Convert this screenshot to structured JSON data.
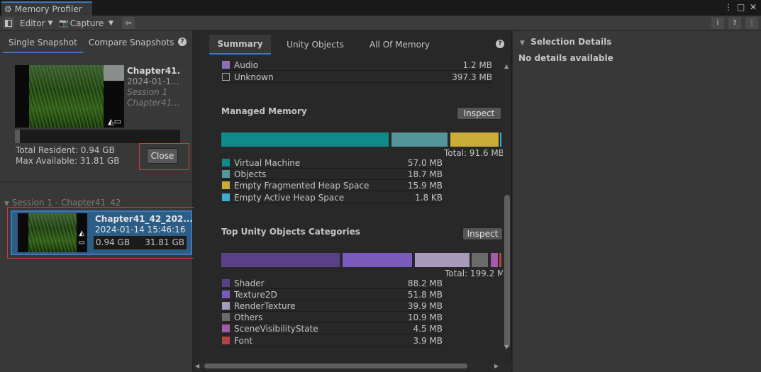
{
  "window": {
    "tab_title": "Memory Profiler"
  },
  "toolbar": {
    "target_label": "Editor",
    "capture_label": "Capture"
  },
  "left": {
    "tabs": [
      "Single Snapshot",
      "Compare Snapshots"
    ],
    "snapshot": {
      "name": "Chapter41...",
      "date": "2024-01-1...",
      "session": "Session 1",
      "project": "Chapter41...",
      "resident_label": "Total Resident: 0.94 GB",
      "available_label": "Max Available: 31.81 GB",
      "resident_fraction": 0.03
    },
    "close_label": "Close",
    "session_header": "Session 1 - Chapter41_42",
    "session_item": {
      "name": "Chapter41_42_202...",
      "date": "2024-01-14 15:46:16",
      "resident": "0.94 GB",
      "available": "31.81 GB"
    }
  },
  "center": {
    "tabs": [
      "Summary",
      "Unity Objects",
      "All Of Memory"
    ],
    "top_rows": [
      {
        "label": "Audio",
        "value": "1.2 MB",
        "color": "#8c6fb8"
      },
      {
        "label": "Unknown",
        "value": "397.3 MB",
        "color": "#282828"
      }
    ],
    "managed": {
      "title": "Managed Memory",
      "inspect_label": "Inspect",
      "total_label": "Total: 91.6 MB",
      "rows": [
        {
          "label": "Virtual Machine",
          "value": "57.0 MB",
          "color": "#0f8a8a"
        },
        {
          "label": "Objects",
          "value": "18.7 MB",
          "color": "#54959a"
        },
        {
          "label": "Empty Fragmented Heap Space",
          "value": "15.9 MB",
          "color": "#c9ad38"
        },
        {
          "label": "Empty Active Heap Space",
          "value": "1.8 KB",
          "color": "#3fa8d4"
        }
      ]
    },
    "unity_objects": {
      "title": "Top Unity Objects Categories",
      "inspect_label": "Inspect",
      "total_label": "Total: 199.2 M",
      "rows": [
        {
          "label": "Shader",
          "value": "88.2 MB",
          "color": "#5a4187"
        },
        {
          "label": "Texture2D",
          "value": "51.8 MB",
          "color": "#7a5bbd"
        },
        {
          "label": "RenderTexture",
          "value": "39.9 MB",
          "color": "#a69cba"
        },
        {
          "label": "Others",
          "value": "10.9 MB",
          "color": "#6b6b6b"
        },
        {
          "label": "SceneVisibilityState",
          "value": "4.5 MB",
          "color": "#a35aa8"
        },
        {
          "label": "Font",
          "value": "3.9 MB",
          "color": "#b44343"
        }
      ]
    }
  },
  "right": {
    "title": "Selection Details",
    "body": "No details available"
  }
}
